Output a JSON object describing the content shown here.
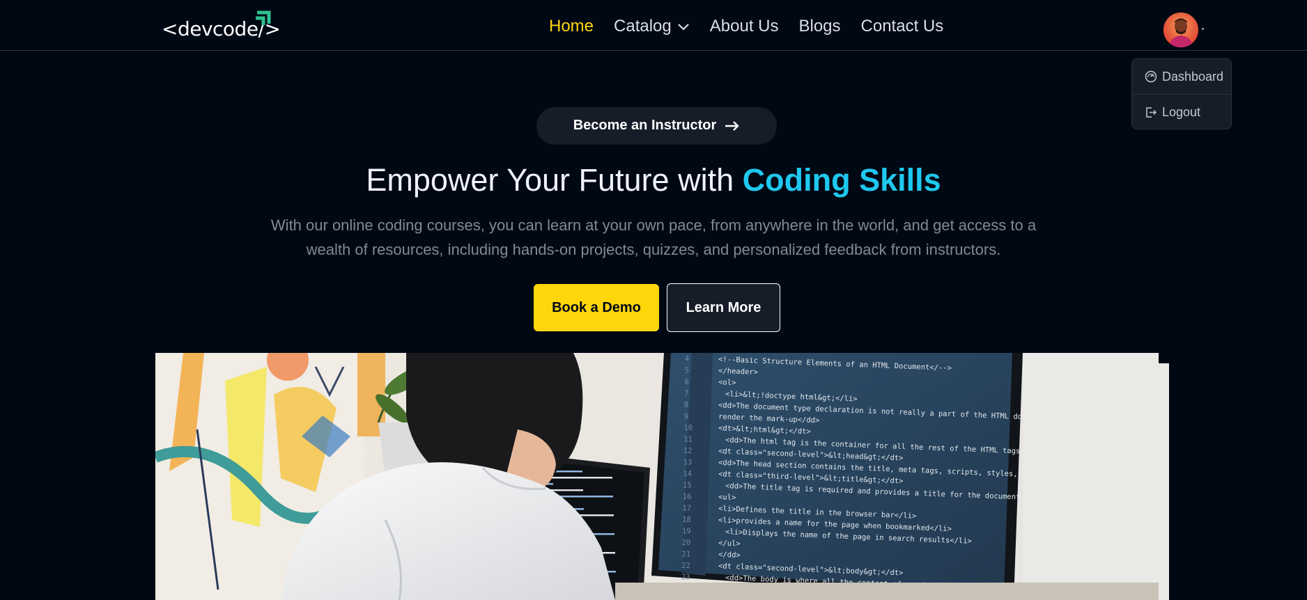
{
  "navbar": {
    "logo": "<devcode/>",
    "links": [
      {
        "label": "Home",
        "active": true
      },
      {
        "label": "Catalog",
        "has_dropdown": true
      },
      {
        "label": "About Us"
      },
      {
        "label": "Blogs"
      },
      {
        "label": "Contact Us"
      }
    ]
  },
  "user_menu": {
    "items": [
      {
        "label": "Dashboard",
        "icon": "dashboard-gauge-icon"
      },
      {
        "label": "Logout",
        "icon": "logout-icon"
      }
    ]
  },
  "hero": {
    "instructor_button": "Become an Instructor",
    "title_prefix": "Empower Your Future with ",
    "title_accent": "Coding Skills",
    "subtitle": "With our online coding courses, you can learn at your own pace, from anywhere in the world, and get access to a wealth of resources, including hands-on projects, quizzes, and personalized feedback from instructors.",
    "primary_button": "Book a Demo",
    "secondary_button": "Learn More"
  },
  "colors": {
    "background": "#000814",
    "accent_yellow": "#ffd60a",
    "accent_cyan": "#1fc8ef",
    "surface": "#161d29"
  },
  "video": {
    "code_lines": [
      "<!--Basic Structure Elements of an HTML Document</-->",
      "</header>",
      "<ol>",
      "<li>&lt;!doctype html&gt;</li>",
      "<dd>The document type declaration is not really a part of the HTML document. The docu",
      "render the mark-up</dd>",
      "<dt>&lt;html&gt;</dt>",
      "<dd>The html tag is the container for all the rest of the HTML tags</dd>",
      "<dt class=\"second-level\">&lt;head&gt;</dt>",
      "<dd>The head section contains the title, meta tags, scripts, styles, and any other nor",
      "<dt class=\"third-level\">&lt;title&gt;</dt>",
      "<dd>The title tag is required and provides a title for the document.",
      "<ul>",
      "<li>Defines the title in the browser bar</li>",
      "<li>provides a name for the page when bookmarked</li>",
      "<li>Displays the name of the page in search results</li>",
      "</ul>",
      "</dd>",
      "<dt class=\"second-level\">&lt;body&gt;</dt>",
      "<dd>The body is where all the content of a web page is displayed. This includes te"
    ],
    "line_numbers": [
      "4",
      "5",
      "6",
      "7",
      "8",
      "9",
      "10",
      "11",
      "12",
      "13",
      "14",
      "15",
      "16",
      "17",
      "18",
      "19",
      "20",
      "21",
      "22",
      "23"
    ]
  }
}
